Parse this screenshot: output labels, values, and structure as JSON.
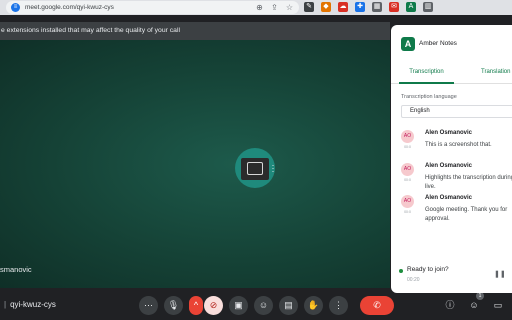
{
  "browser": {
    "url": "meet.google.com/qyi-kwuz-cys",
    "toolbar_icons": [
      "translate-icon",
      "share-icon",
      "star-icon"
    ],
    "extensions": [
      {
        "name": "pen-extension-icon",
        "glyph": "✎",
        "color": "#3c4043"
      },
      {
        "name": "tag-extension-icon",
        "glyph": "◆",
        "color": "#e37400"
      },
      {
        "name": "cloud-extension-icon",
        "glyph": "☁",
        "color": "#d93025"
      },
      {
        "name": "puzzle-extension-icon",
        "glyph": "✚",
        "color": "#1a73e8"
      },
      {
        "name": "grid-extension-icon",
        "glyph": "▦",
        "color": "#5f6368"
      },
      {
        "name": "mail-extension-icon",
        "glyph": "✉",
        "color": "#d93025"
      },
      {
        "name": "amber-extension-icon",
        "glyph": "A",
        "color": "#0f7a4a"
      },
      {
        "name": "sidepanel-icon",
        "glyph": "▥",
        "color": "#5f6368"
      }
    ]
  },
  "banner": {
    "text": "e extensions installed that may affect the quality of your call"
  },
  "participant": {
    "name": "smanovic"
  },
  "meeting": {
    "code": "qyi-kwuz-cys"
  },
  "toolbar": {
    "more_label": "⋯",
    "mic_glyph": "🎙",
    "caret_glyph": "^",
    "cam_glyph": "⊘",
    "present_glyph": "▣",
    "emoji_glyph": "☺",
    "captions_glyph": "▤",
    "hand_glyph": "✋",
    "options_glyph": "⋮",
    "end_glyph": "✆",
    "people_count": "1"
  },
  "panel": {
    "title": "Amber Notes",
    "logo_letter": "A",
    "tabs": [
      "Transcription",
      "Translation"
    ],
    "language_label": "Transcription language",
    "language_value": "English",
    "entries": [
      {
        "initials": "AO",
        "time": "00:0",
        "name": "Alen Osmanovic",
        "text": "This is a screenshot that."
      },
      {
        "initials": "AO",
        "time": "00:0",
        "name": "Alen Osmanovic",
        "text": "Highlights the transcription during live."
      },
      {
        "initials": "AO",
        "time": "00:0",
        "name": "Alen Osmanovic",
        "text": "Google meeting. Thank you for approval."
      }
    ],
    "ready_text": "Ready to join?",
    "ready_time": "00:20"
  },
  "colors": {
    "accent": "#0f7a4a",
    "end_call": "#ea4335",
    "stage": "#154236"
  }
}
